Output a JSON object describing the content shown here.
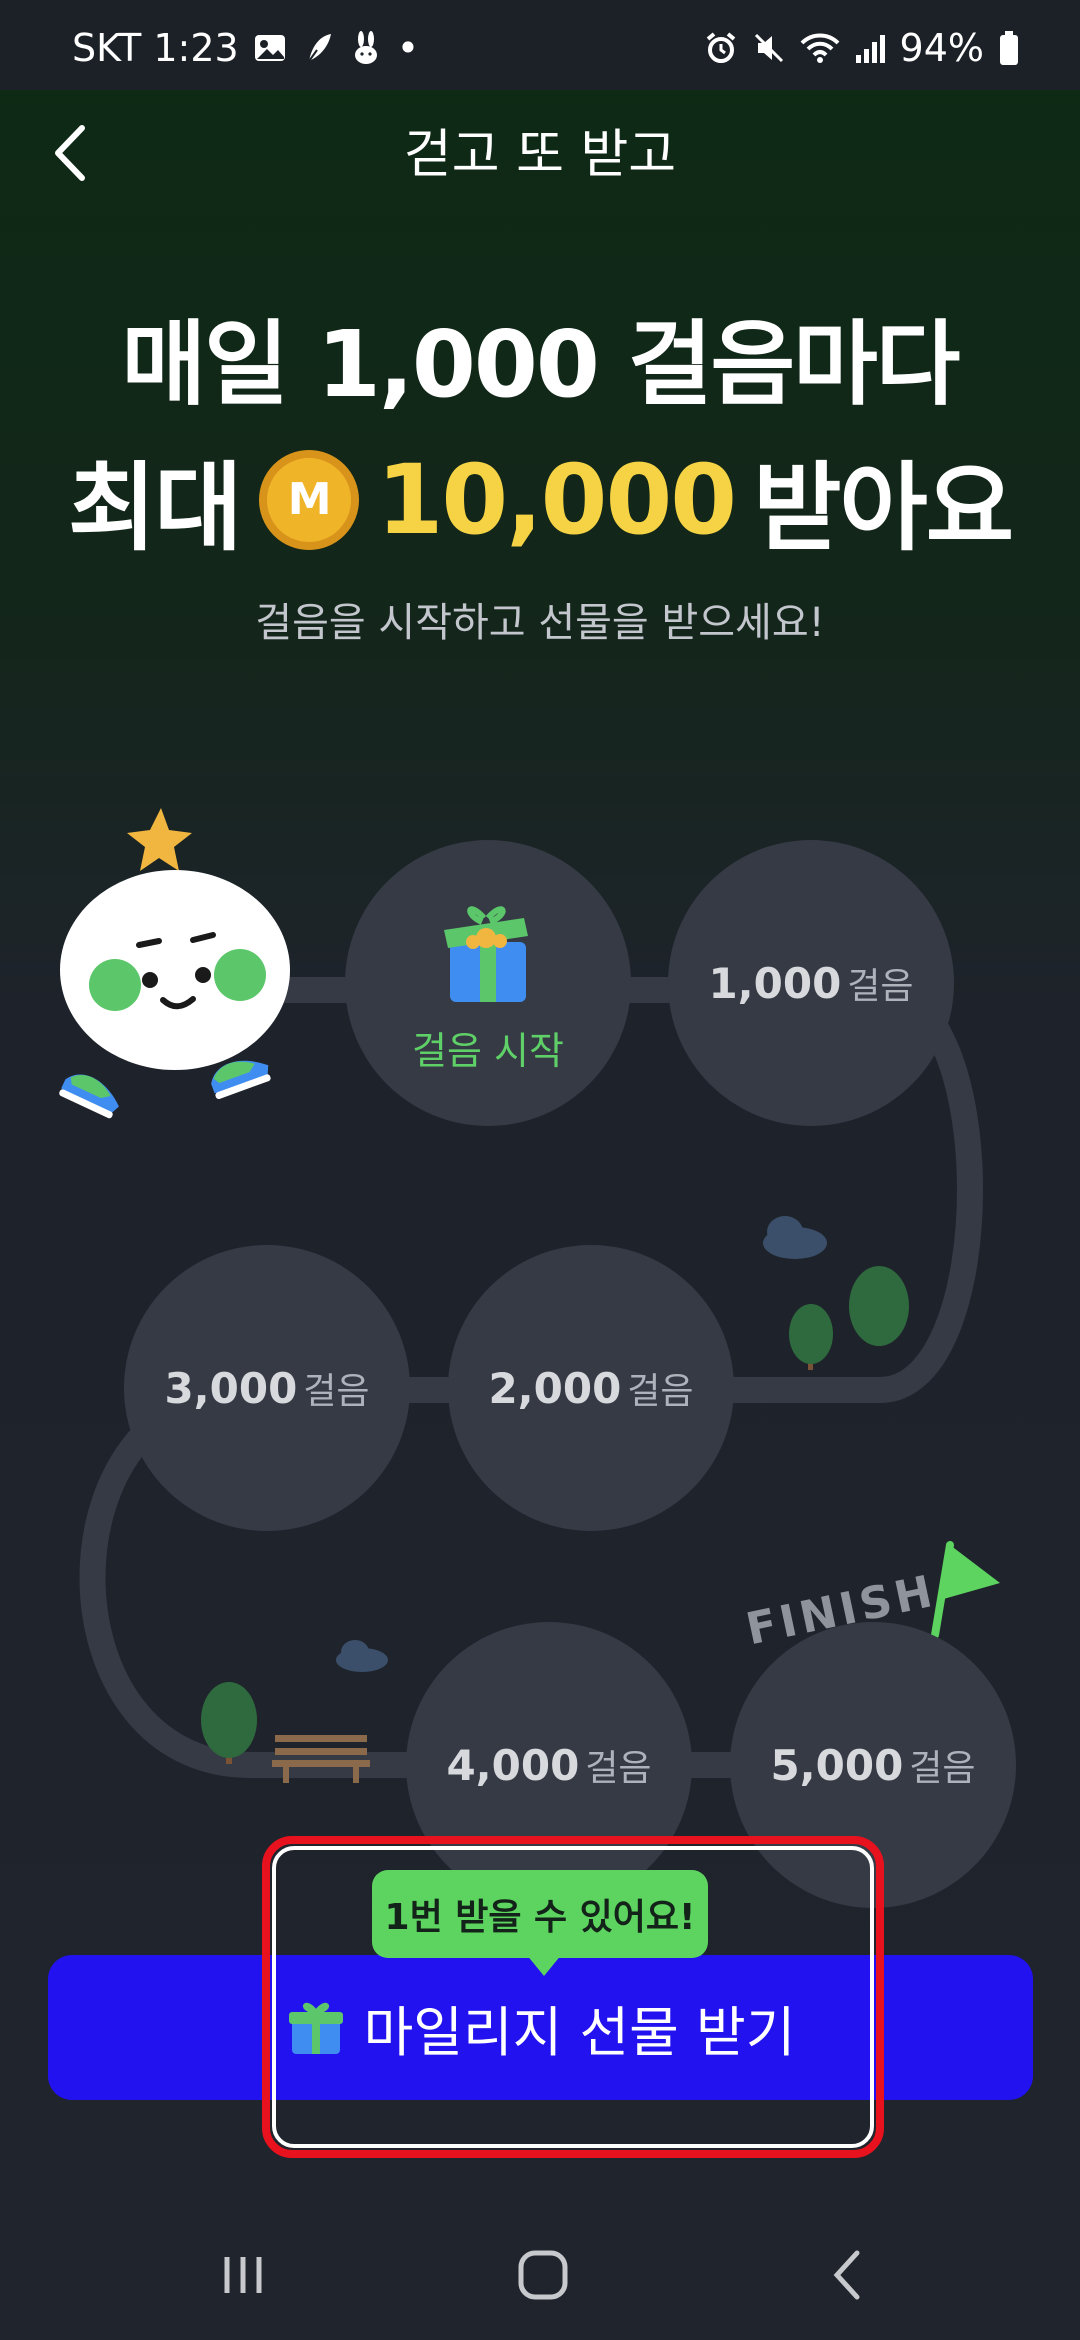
{
  "status_bar": {
    "carrier_time": "SKT 1:23",
    "dot": "•",
    "battery": "94%"
  },
  "header": {
    "title": "걷고 또 받고",
    "back_icon": "chevron-left-icon"
  },
  "hero": {
    "line1": "매일 1,000 걸음마다",
    "line2_prefix": "최대",
    "coin_letter": "M",
    "amount": "10,000",
    "line2_suffix": "받아요",
    "subtitle": "걸음을 시작하고 선물을 받으세요!"
  },
  "track": {
    "start_label": "걸음 시작",
    "unit": "걸음",
    "steps": [
      "1,000",
      "2,000",
      "3,000",
      "4,000",
      "5,000"
    ],
    "finish_label": "FINISH"
  },
  "cta": {
    "tooltip": "1번 받을 수 있어요!",
    "label": "마일리지 선물 받기",
    "icon": "gift-icon"
  },
  "colors": {
    "accent_blue": "#2212f0",
    "green": "#5cd45f",
    "gold": "#f5d344",
    "highlight_red": "#e8121e"
  }
}
